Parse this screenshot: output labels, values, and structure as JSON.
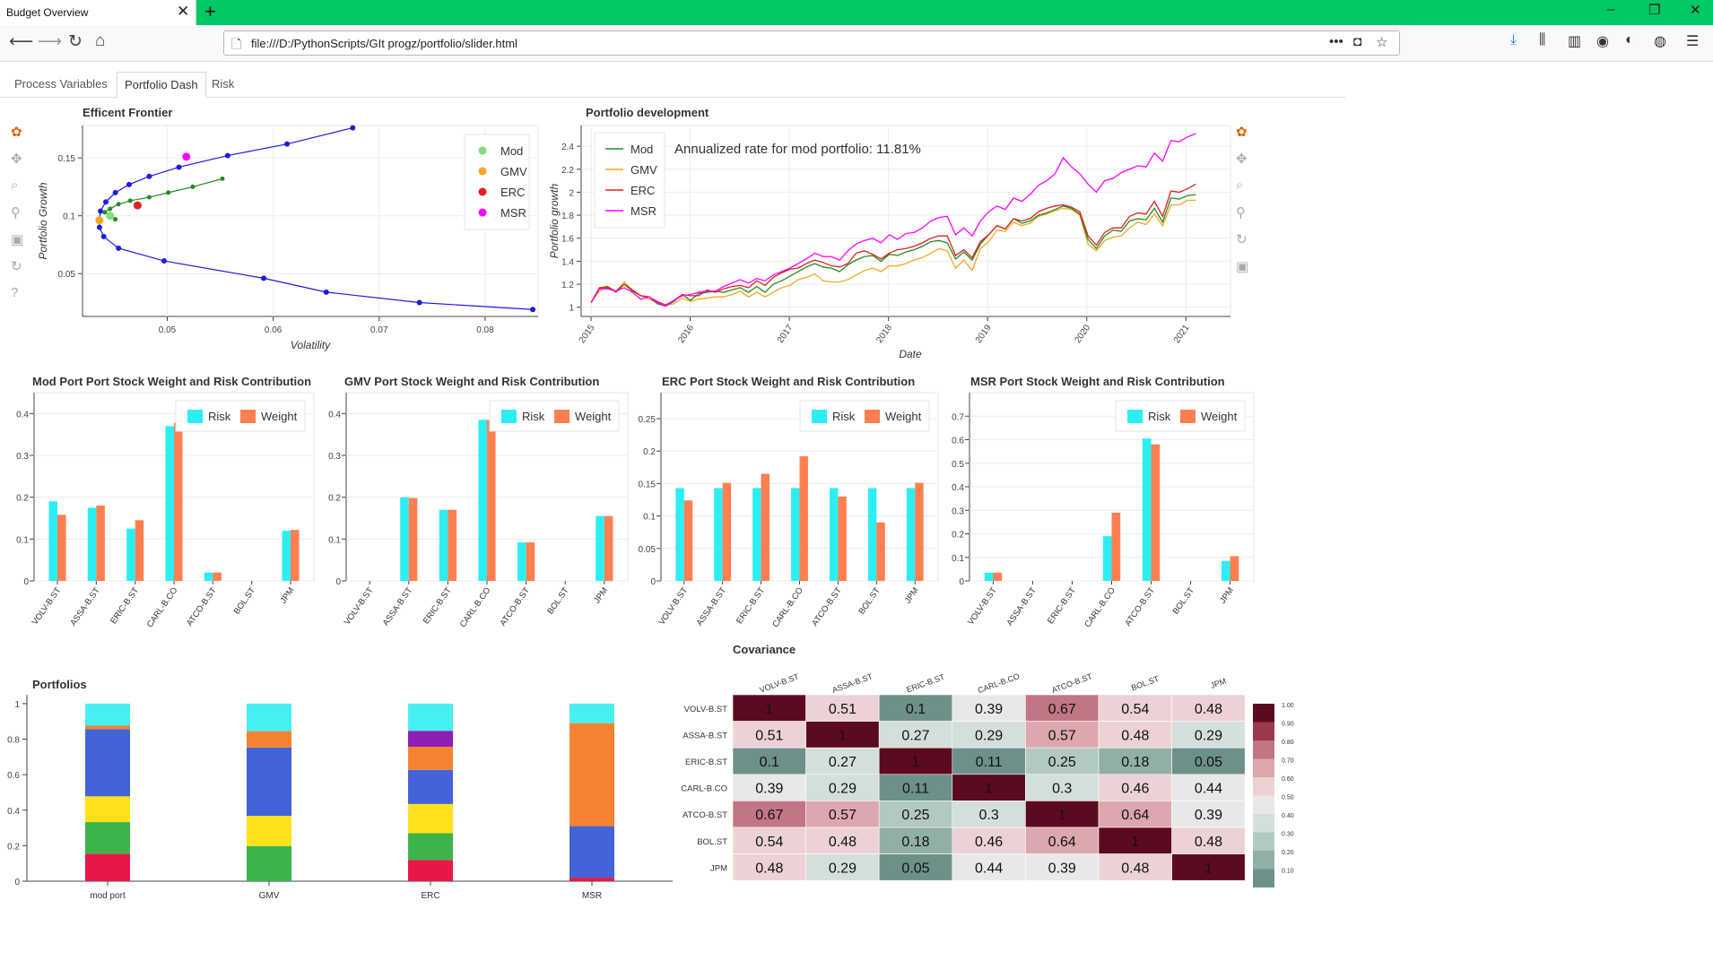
{
  "browser": {
    "tab_title": "Budget Overview",
    "url": "file:///D:/PythonScripts/GIt progz/portfolio/slider.html"
  },
  "page_tabs": [
    "Process Variables",
    "Portfolio Dash",
    "Risk"
  ],
  "frontier": {
    "title": "Efficent Frontier",
    "xlabel": "Volatility",
    "ylabel": "Portfolio Growth",
    "legend": [
      "Mod",
      "GMV",
      "ERC",
      "MSR"
    ]
  },
  "development": {
    "title": "Portfolio development",
    "xlabel": "Date",
    "ylabel": "Portfolio growth",
    "legend": [
      "Mod",
      "GMV",
      "ERC",
      "MSR"
    ],
    "annotation": "Annualized rate for mod portfolio: 11.81%"
  },
  "weights": {
    "titles": [
      "Mod Port Port Stock Weight and Risk Contribution",
      "GMV Port Stock Weight and Risk Contribution",
      "ERC Port Stock Weight and Risk Contribution",
      "MSR Port Stock Weight and Risk Contribution"
    ],
    "legend": [
      "Risk",
      "Weight"
    ]
  },
  "portfolios": {
    "title": "Portfolios"
  },
  "covariance": {
    "title": "Covariance"
  },
  "colors": {
    "mod": "#228b22",
    "gmv": "#f5a623",
    "erc": "#e0201c",
    "msr": "#ff00ff",
    "frontier_line": "#1c1ce0",
    "risk": "#2ceef2",
    "weight": "#ff7f50",
    "stock_colors": [
      "#e8174a",
      "#3cb44b",
      "#ffe119",
      "#4363d8",
      "#f58231",
      "#911eb4",
      "#46f0f0"
    ]
  },
  "chart_data": [
    {
      "type": "line",
      "name": "frontier",
      "xlim": [
        0.042,
        0.085
      ],
      "ylim": [
        0.013,
        0.178
      ],
      "xticks": [
        0.05,
        0.06,
        0.07,
        0.08
      ],
      "yticks": [
        0.05,
        0.1,
        0.15
      ],
      "efficient_frontier": {
        "x": [
          0.0845,
          0.0738,
          0.065,
          0.0591,
          0.0497,
          0.0454,
          0.044,
          0.0436,
          0.0436,
          0.0437,
          0.0442,
          0.0451,
          0.0464,
          0.0483,
          0.0511,
          0.0557,
          0.0613,
          0.0675
        ],
        "y": [
          0.019,
          0.025,
          0.034,
          0.046,
          0.061,
          0.072,
          0.082,
          0.09,
          0.097,
          0.104,
          0.112,
          0.12,
          0.127,
          0.134,
          0.142,
          0.152,
          0.162,
          0.176
        ]
      },
      "mod_frontier": {
        "x": [
          0.0451,
          0.0441,
          0.0446,
          0.0454,
          0.0465,
          0.0483,
          0.0501,
          0.0524,
          0.0552
        ],
        "y": [
          0.097,
          0.103,
          0.106,
          0.11,
          0.113,
          0.116,
          0.12,
          0.125,
          0.132
        ]
      },
      "points": [
        {
          "name": "Mod",
          "x": 0.0446,
          "y": 0.1
        },
        {
          "name": "GMV",
          "x": 0.0436,
          "y": 0.096
        },
        {
          "name": "ERC",
          "x": 0.0472,
          "y": 0.109
        },
        {
          "name": "MSR",
          "x": 0.0518,
          "y": 0.151
        }
      ]
    },
    {
      "type": "line",
      "name": "development",
      "x_start": 2015.0,
      "x_end": 2021.1,
      "xlim": [
        2014.9,
        2021.45
      ],
      "ylim": [
        0.92,
        2.58
      ],
      "xticks": [
        2015,
        2016,
        2017,
        2018,
        2019,
        2020,
        2021
      ],
      "yticks": [
        1,
        1.2,
        1.4,
        1.6,
        1.8,
        2,
        2.2,
        2.4
      ],
      "series": [
        {
          "name": "Mod",
          "values": [
            1.04,
            1.16,
            1.17,
            1.14,
            1.2,
            1.14,
            1.1,
            1.09,
            1.03,
            1.01,
            1.05,
            1.11,
            1.06,
            1.12,
            1.13,
            1.14,
            1.13,
            1.15,
            1.17,
            1.13,
            1.18,
            1.13,
            1.2,
            1.23,
            1.27,
            1.31,
            1.35,
            1.38,
            1.35,
            1.34,
            1.31,
            1.37,
            1.41,
            1.44,
            1.45,
            1.4,
            1.46,
            1.45,
            1.48,
            1.5,
            1.53,
            1.57,
            1.58,
            1.56,
            1.42,
            1.48,
            1.41,
            1.55,
            1.63,
            1.71,
            1.68,
            1.77,
            1.73,
            1.75,
            1.8,
            1.82,
            1.85,
            1.88,
            1.86,
            1.81,
            1.59,
            1.51,
            1.62,
            1.67,
            1.66,
            1.75,
            1.77,
            1.76,
            1.86,
            1.74,
            1.95,
            1.94,
            1.97,
            1.98
          ]
        },
        {
          "name": "GMV",
          "values": [
            1.04,
            1.14,
            1.18,
            1.14,
            1.22,
            1.15,
            1.1,
            1.07,
            1.04,
            1.02,
            1.03,
            1.08,
            1.05,
            1.07,
            1.08,
            1.09,
            1.09,
            1.11,
            1.14,
            1.09,
            1.13,
            1.09,
            1.13,
            1.17,
            1.19,
            1.24,
            1.26,
            1.29,
            1.23,
            1.22,
            1.22,
            1.24,
            1.28,
            1.32,
            1.34,
            1.31,
            1.36,
            1.36,
            1.38,
            1.41,
            1.43,
            1.47,
            1.51,
            1.49,
            1.34,
            1.41,
            1.32,
            1.51,
            1.57,
            1.67,
            1.66,
            1.74,
            1.71,
            1.73,
            1.79,
            1.81,
            1.84,
            1.86,
            1.85,
            1.8,
            1.55,
            1.49,
            1.58,
            1.61,
            1.62,
            1.69,
            1.74,
            1.72,
            1.81,
            1.71,
            1.89,
            1.89,
            1.93,
            1.93
          ]
        },
        {
          "name": "ERC",
          "values": [
            1.04,
            1.17,
            1.18,
            1.13,
            1.2,
            1.15,
            1.1,
            1.09,
            1.05,
            1.02,
            1.06,
            1.11,
            1.1,
            1.1,
            1.15,
            1.13,
            1.16,
            1.18,
            1.19,
            1.17,
            1.23,
            1.19,
            1.26,
            1.3,
            1.33,
            1.34,
            1.38,
            1.41,
            1.39,
            1.36,
            1.35,
            1.38,
            1.47,
            1.49,
            1.46,
            1.42,
            1.47,
            1.5,
            1.51,
            1.53,
            1.56,
            1.6,
            1.62,
            1.62,
            1.45,
            1.5,
            1.43,
            1.57,
            1.63,
            1.71,
            1.68,
            1.77,
            1.75,
            1.77,
            1.83,
            1.86,
            1.88,
            1.89,
            1.87,
            1.83,
            1.62,
            1.54,
            1.65,
            1.69,
            1.69,
            1.79,
            1.82,
            1.81,
            1.92,
            1.79,
            2.01,
            2.0,
            2.03,
            2.07
          ]
        },
        {
          "name": "MSR",
          "values": [
            1.04,
            1.16,
            1.16,
            1.14,
            1.17,
            1.13,
            1.07,
            1.09,
            1.04,
            1.01,
            1.06,
            1.1,
            1.11,
            1.13,
            1.14,
            1.14,
            1.18,
            1.21,
            1.24,
            1.21,
            1.25,
            1.23,
            1.28,
            1.31,
            1.34,
            1.38,
            1.42,
            1.47,
            1.44,
            1.44,
            1.41,
            1.49,
            1.55,
            1.58,
            1.6,
            1.56,
            1.63,
            1.59,
            1.64,
            1.65,
            1.69,
            1.75,
            1.78,
            1.79,
            1.63,
            1.69,
            1.62,
            1.75,
            1.83,
            1.88,
            1.85,
            1.95,
            1.92,
            1.98,
            2.06,
            2.1,
            2.16,
            2.3,
            2.22,
            2.16,
            2.07,
            2.0,
            2.1,
            2.12,
            2.17,
            2.2,
            2.23,
            2.22,
            2.34,
            2.27,
            2.45,
            2.44,
            2.48,
            2.51
          ]
        }
      ]
    },
    {
      "type": "bar",
      "name": "mod_weights",
      "categories": [
        "VOLV-B.ST",
        "ASSA-B.ST",
        "ERIC-B.ST",
        "CARL-B.CO",
        "ATCO-B.ST",
        "BOL.ST",
        "JPM"
      ],
      "ylim": [
        0,
        0.45
      ],
      "yticks": [
        0,
        0.1,
        0.2,
        0.3,
        0.4
      ],
      "series": [
        {
          "name": "Risk",
          "values": [
            0.19,
            0.175,
            0.125,
            0.37,
            0.02,
            0,
            0.12
          ]
        },
        {
          "name": "Weight",
          "values": [
            0.158,
            0.18,
            0.145,
            0.378,
            0.02,
            0,
            0.122
          ]
        }
      ]
    },
    {
      "type": "bar",
      "name": "gmv_weights",
      "categories": [
        "VOLV-B.ST",
        "ASSA-B.ST",
        "ERIC-B.ST",
        "CARL-B.CO",
        "ATCO-B.ST",
        "BOL.ST",
        "JPM"
      ],
      "ylim": [
        0,
        0.45
      ],
      "yticks": [
        0,
        0.1,
        0.2,
        0.3,
        0.4
      ],
      "series": [
        {
          "name": "Risk",
          "values": [
            0,
            0.2,
            0.17,
            0.385,
            0.092,
            0,
            0.155
          ]
        },
        {
          "name": "Weight",
          "values": [
            0,
            0.198,
            0.17,
            0.385,
            0.092,
            0,
            0.155
          ]
        }
      ]
    },
    {
      "type": "bar",
      "name": "erc_weights",
      "categories": [
        "VOLV-B.ST",
        "ASSA-B.ST",
        "ERIC-B.ST",
        "CARL-B.CO",
        "ATCO-B.ST",
        "BOL.ST",
        "JPM"
      ],
      "ylim": [
        0,
        0.29
      ],
      "yticks": [
        0,
        0.05,
        0.1,
        0.15,
        0.2,
        0.25
      ],
      "series": [
        {
          "name": "Risk",
          "values": [
            0.143,
            0.143,
            0.143,
            0.143,
            0.143,
            0.143,
            0.143
          ]
        },
        {
          "name": "Weight",
          "values": [
            0.124,
            0.151,
            0.165,
            0.192,
            0.13,
            0.09,
            0.151
          ]
        }
      ]
    },
    {
      "type": "bar",
      "name": "msr_weights",
      "categories": [
        "VOLV-B.ST",
        "ASSA-B.ST",
        "ERIC-B.ST",
        "CARL-B.CO",
        "ATCO-B.ST",
        "BOL.ST",
        "JPM"
      ],
      "ylim": [
        0,
        0.8
      ],
      "yticks": [
        0,
        0.1,
        0.2,
        0.3,
        0.4,
        0.5,
        0.6,
        0.7
      ],
      "series": [
        {
          "name": "Risk",
          "values": [
            0.035,
            0,
            0,
            0.19,
            0.605,
            0,
            0.085
          ]
        },
        {
          "name": "Weight",
          "values": [
            0.035,
            0,
            0,
            0.29,
            0.58,
            0,
            0.105
          ]
        }
      ]
    },
    {
      "type": "bar",
      "name": "portfolios",
      "stacked": true,
      "categories": [
        "mod port",
        "GMV",
        "ERC",
        "MSR"
      ],
      "ylim": [
        0,
        1.05
      ],
      "yticks": [
        0,
        0.2,
        0.4,
        0.6,
        0.8,
        1
      ],
      "series": [
        {
          "values": [
            0.155,
            0,
            0.12,
            0.02
          ]
        },
        {
          "values": [
            0.178,
            0.198,
            0.15,
            0
          ]
        },
        {
          "values": [
            0.145,
            0.17,
            0.165,
            0
          ]
        },
        {
          "values": [
            0.378,
            0.385,
            0.192,
            0.29
          ]
        },
        {
          "values": [
            0.02,
            0.092,
            0.13,
            0.58
          ]
        },
        {
          "values": [
            0,
            0,
            0.09,
            0
          ]
        },
        {
          "values": [
            0.124,
            0.155,
            0.153,
            0.11
          ]
        }
      ]
    },
    {
      "type": "heatmap",
      "name": "covariance",
      "labels": [
        "VOLV-B.ST",
        "ASSA-B.ST",
        "ERIC-B.ST",
        "CARL-B.CO",
        "ATCO-B.ST",
        "BOL.ST",
        "JPM"
      ],
      "matrix": [
        [
          1,
          0.51,
          0.1,
          0.39,
          0.67,
          0.54,
          0.48
        ],
        [
          0.51,
          1,
          0.27,
          0.29,
          0.57,
          0.48,
          0.29
        ],
        [
          0.1,
          0.27,
          1,
          0.11,
          0.25,
          0.18,
          0.05
        ],
        [
          0.39,
          0.29,
          0.11,
          1,
          0.3,
          0.46,
          0.44
        ],
        [
          0.67,
          0.57,
          0.25,
          0.3,
          1,
          0.64,
          0.39
        ],
        [
          0.54,
          0.48,
          0.18,
          0.46,
          0.64,
          1,
          0.48
        ],
        [
          0.48,
          0.29,
          0.05,
          0.44,
          0.39,
          0.48,
          1
        ]
      ],
      "colorbar_ticks": [
        "1.00",
        "0.90",
        "0.80",
        "0.70",
        "0.60",
        "0.50",
        "0.40",
        "0.30",
        "0.20",
        "0.10"
      ],
      "colorbar_colors": [
        "#5c0a1f",
        "#9a3b4d",
        "#c27583",
        "#dca7ad",
        "#ecd2d4",
        "#e8e8e8",
        "#d3dfdb",
        "#b2c8c1",
        "#92afa6",
        "#6e908a"
      ]
    }
  ]
}
